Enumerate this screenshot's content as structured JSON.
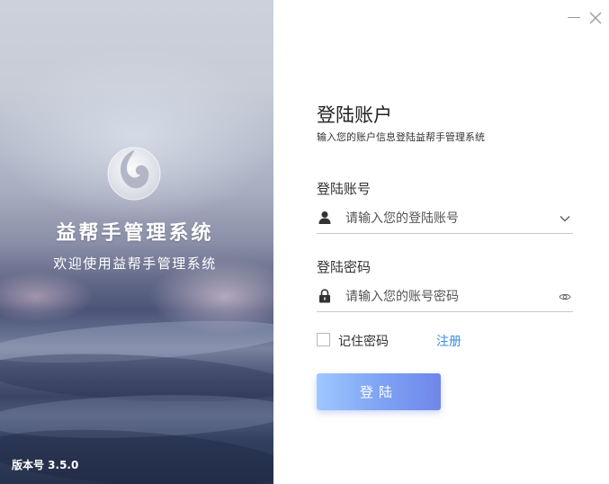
{
  "hero": {
    "title": "益帮手管理系统",
    "subtitle": "欢迎使用益帮手管理系统",
    "version": "版本号 3.5.0",
    "logo_icon": "swirl-logo-icon"
  },
  "window_controls": {
    "minimize_icon": "minimize-icon",
    "close_icon": "close-icon"
  },
  "form": {
    "title": "登陆账户",
    "description": "输入您的账户信息登陆益帮手管理系统",
    "account": {
      "label": "登陆账号",
      "placeholder": "请输入您的登陆账号",
      "value": "",
      "leading_icon": "user-icon",
      "trailing_icon": "chevron-down-icon"
    },
    "password": {
      "label": "登陆密码",
      "placeholder": "请输入您的账号密码",
      "value": "",
      "leading_icon": "lock-icon",
      "trailing_icon": "eye-icon"
    },
    "remember": {
      "label": "记住密码",
      "checked": false
    },
    "register_label": "注册",
    "login_button": "登陆"
  },
  "colors": {
    "accent_link": "#3a8ee6",
    "button_gradient_start": "#9ec8ff",
    "button_gradient_end": "#6f86ea"
  }
}
